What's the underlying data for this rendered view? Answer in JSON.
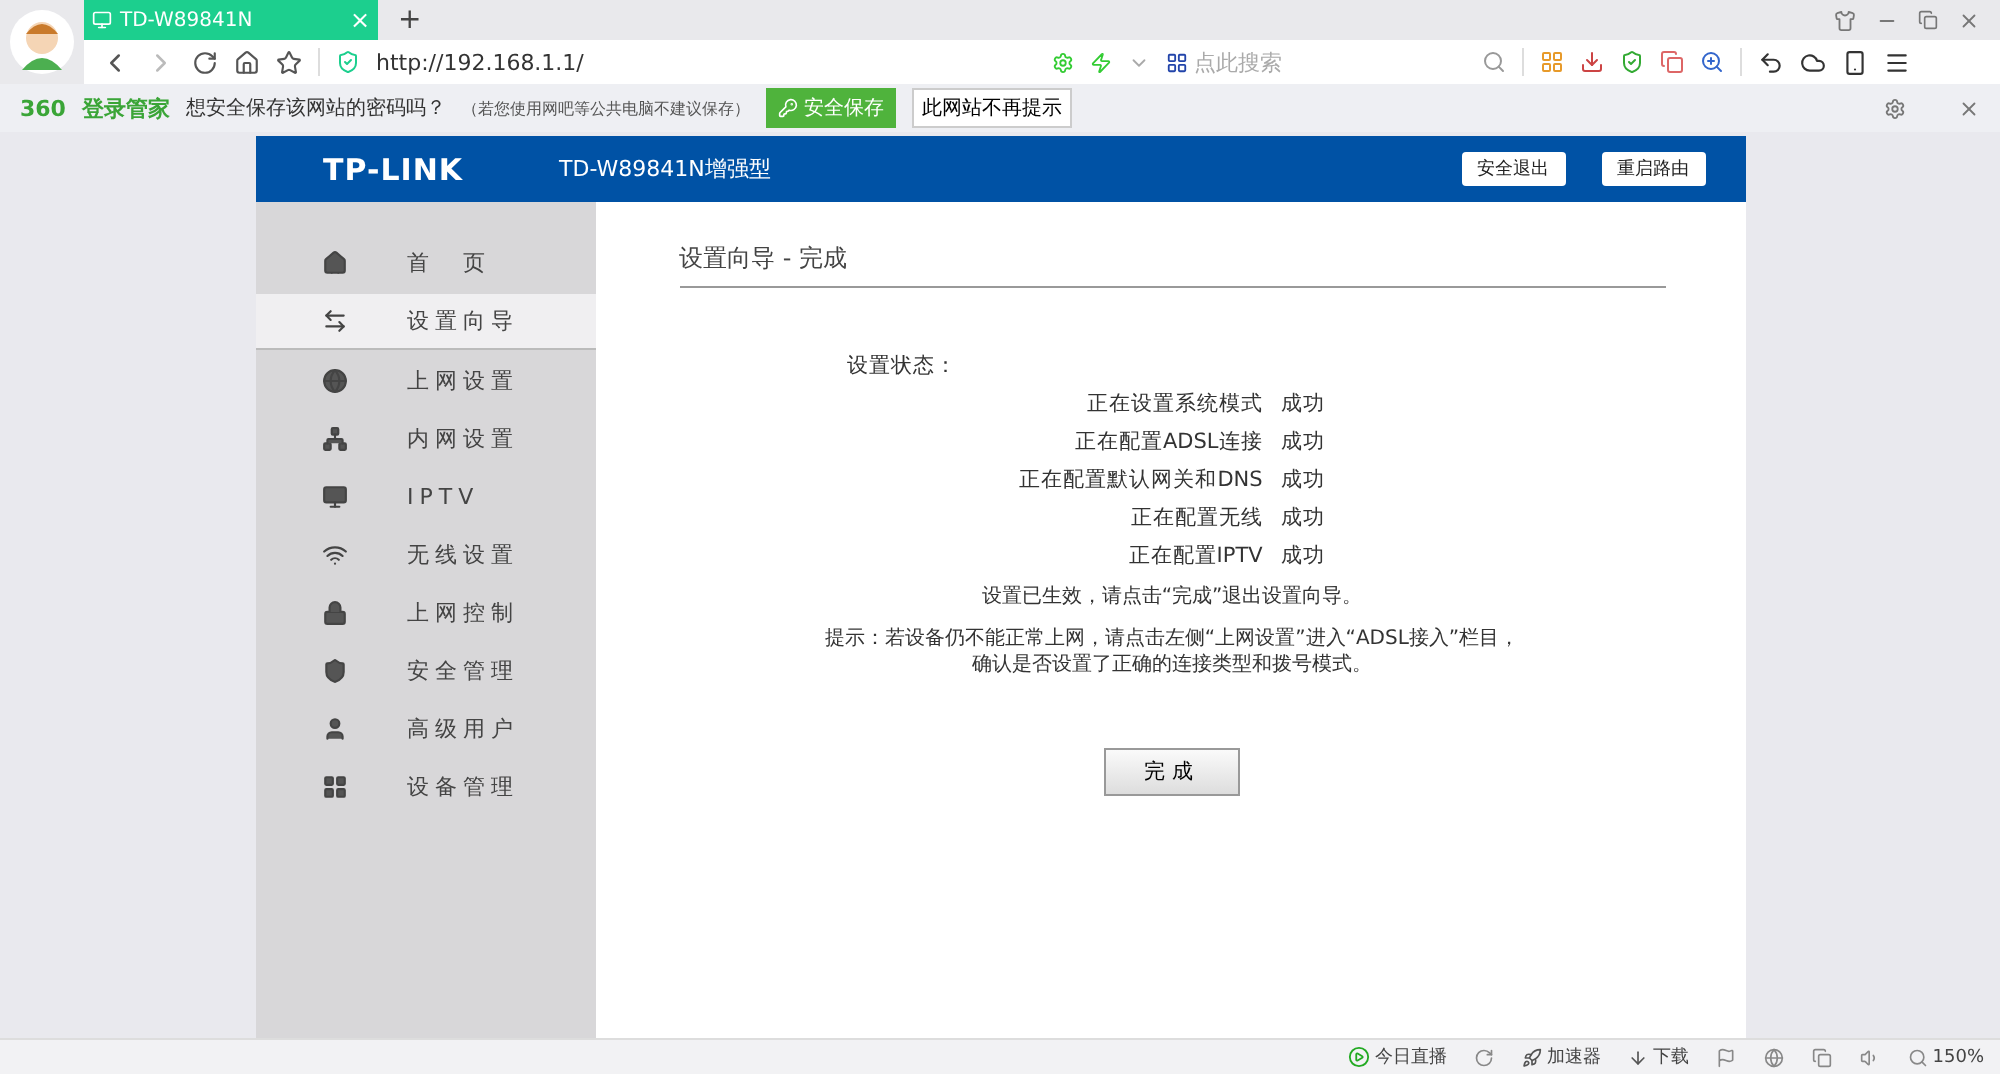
{
  "browser": {
    "tab": {
      "title": "TD-W89841N",
      "close": "×"
    },
    "new_tab": "+",
    "url": "http://192.168.1.1/",
    "search": {
      "placeholder": "点此搜索"
    }
  },
  "password_bar": {
    "brand": "360",
    "brand_name": "登录管家",
    "question": "想安全保存该网站的密码吗？",
    "note": "（若您使用网吧等公共电脑不建议保存）",
    "save_button": "安全保存",
    "never_button": "此网站不再提示"
  },
  "router": {
    "logo": "TP-LINK",
    "model": "TD-W89841N增强型",
    "header_buttons": [
      "安全退出",
      "重启路由"
    ],
    "sidebar": {
      "items": [
        {
          "label": "首　页",
          "selected": false
        },
        {
          "label": "设置向导",
          "selected": true
        },
        {
          "label": "上网设置",
          "selected": false
        },
        {
          "label": "内网设置",
          "selected": false
        },
        {
          "label": "IPTV",
          "selected": false
        },
        {
          "label": "无线设置",
          "selected": false
        },
        {
          "label": "上网控制",
          "selected": false
        },
        {
          "label": "安全管理",
          "selected": false
        },
        {
          "label": "高级用户",
          "selected": false
        },
        {
          "label": "设备管理",
          "selected": false
        }
      ]
    },
    "content": {
      "title": "设置向导 - 完成",
      "status_label": "设置状态：",
      "statuses": [
        {
          "task": "正在设置系统模式",
          "result": "成功"
        },
        {
          "task": "正在配置ADSL连接",
          "result": "成功"
        },
        {
          "task": "正在配置默认网关和DNS",
          "result": "成功"
        },
        {
          "task": "正在配置无线",
          "result": "成功"
        },
        {
          "task": "正在配置IPTV",
          "result": "成功"
        }
      ],
      "effect_note": "设置已生效，请点击“完成”退出设置向导。",
      "hint_lines": [
        "提示：若设备仍不能正常上网，请点击左侧“上网设置”进入“ADSL接入”栏目，",
        "确认是否设置了正确的连接类型和拨号模式。"
      ],
      "finish_button": "完成"
    }
  },
  "status_bar": {
    "live": "今日直播",
    "accelerator": "加速器",
    "download": "下载",
    "zoom": "150%"
  }
}
